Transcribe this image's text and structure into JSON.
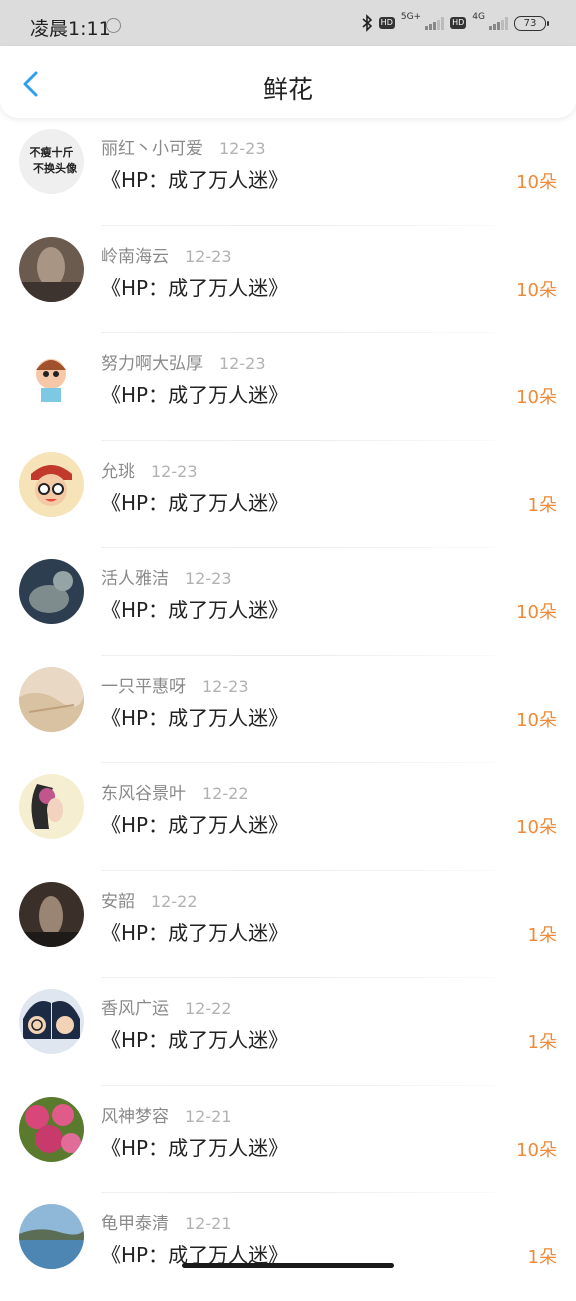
{
  "status_bar": {
    "time": "凌晨1:11",
    "hd1": "HD",
    "net1": "5G+",
    "hd2": "HD",
    "net2": "4G",
    "battery": "73"
  },
  "header": {
    "title": "鲜花",
    "back_icon": "chevron-left-icon",
    "accent_color": "#2c9ff0"
  },
  "colors": {
    "amount": "#ef8a3a",
    "username": "#8a8a8a",
    "date": "#b2b2b2"
  },
  "items": [
    {
      "user": "丽红丶小可爱",
      "date": "12-23",
      "book": "《HP：成了万人迷》",
      "amount": "10朵",
      "avatar_text": [
        "不瘦十斤",
        "不换头像"
      ]
    },
    {
      "user": "岭南海云",
      "date": "12-23",
      "book": "《HP：成了万人迷》",
      "amount": "10朵"
    },
    {
      "user": "努力啊大弘厚",
      "date": "12-23",
      "book": "《HP：成了万人迷》",
      "amount": "10朵"
    },
    {
      "user": "允珧",
      "date": "12-23",
      "book": "《HP：成了万人迷》",
      "amount": "1朵"
    },
    {
      "user": "活人雅洁",
      "date": "12-23",
      "book": "《HP：成了万人迷》",
      "amount": "10朵"
    },
    {
      "user": "一只平惠呀",
      "date": "12-23",
      "book": "《HP：成了万人迷》",
      "amount": "10朵"
    },
    {
      "user": "东风谷景叶",
      "date": "12-22",
      "book": "《HP：成了万人迷》",
      "amount": "10朵"
    },
    {
      "user": "安韶",
      "date": "12-22",
      "book": "《HP：成了万人迷》",
      "amount": "1朵"
    },
    {
      "user": "香风广运",
      "date": "12-22",
      "book": "《HP：成了万人迷》",
      "amount": "1朵"
    },
    {
      "user": "风神梦容",
      "date": "12-21",
      "book": "《HP：成了万人迷》",
      "amount": "10朵"
    },
    {
      "user": "龟甲泰清",
      "date": "12-21",
      "book": "《HP：成了万人迷》",
      "amount": "1朵"
    }
  ]
}
